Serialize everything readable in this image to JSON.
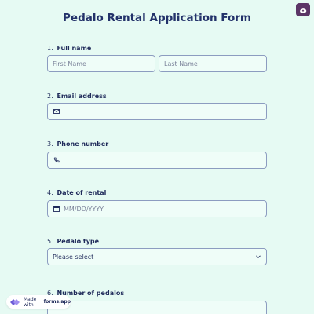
{
  "form": {
    "title": "Pedalo Rental Application Form"
  },
  "questions": {
    "full_name": {
      "number": "1.",
      "label": "Full name",
      "first_placeholder": "First Name",
      "last_placeholder": "Last Name"
    },
    "email": {
      "number": "2.",
      "label": "Email address"
    },
    "phone": {
      "number": "3.",
      "label": "Phone number"
    },
    "date": {
      "number": "4.",
      "label": "Date of rental",
      "placeholder": "MM/DD/YYYY"
    },
    "pedalo_type": {
      "number": "5.",
      "label": "Pedalo type",
      "selected": "Please select"
    },
    "num_pedalos": {
      "number": "6.",
      "label": "Number of pedalos"
    }
  },
  "footer": {
    "made_with": "Made with",
    "brand": "forms.app"
  },
  "icons": {
    "save": "cloud-upload-icon",
    "email": "envelope-icon",
    "phone": "phone-icon",
    "date": "calendar-icon",
    "select": "chevron-down-icon",
    "brand": "forms-app-logo-icon"
  },
  "colors": {
    "background": "#e6faf3",
    "accent": "#5b3566",
    "text": "#1f2a5a",
    "border": "#8c9cc0"
  }
}
